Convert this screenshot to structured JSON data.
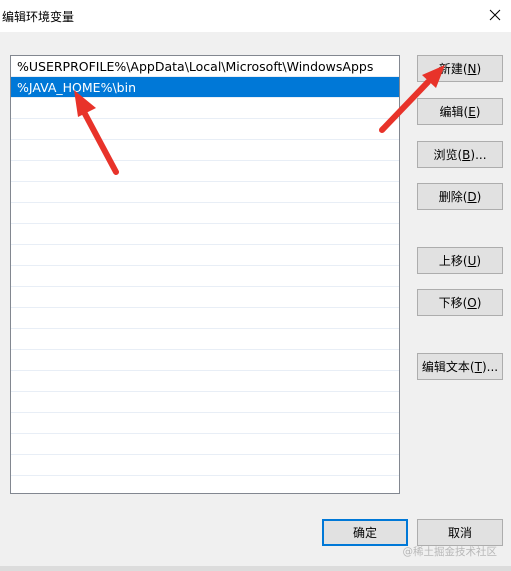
{
  "window": {
    "title": "编辑环境变量",
    "close_glyph": "✕"
  },
  "path_list": {
    "items": [
      {
        "text": "%USERPROFILE%\\AppData\\Local\\Microsoft\\WindowsApps",
        "selected": false
      },
      {
        "text": "%JAVA_HOME%\\bin",
        "selected": true
      }
    ]
  },
  "buttons": {
    "new": {
      "label": "新建(",
      "key": "N",
      "end": ")"
    },
    "edit": {
      "label": "编辑(",
      "key": "E",
      "end": ")"
    },
    "browse": {
      "label": "浏览(",
      "key": "B",
      "end": ")..."
    },
    "delete": {
      "label": "删除(",
      "key": "D",
      "end": ")"
    },
    "move_up": {
      "label": "上移(",
      "key": "U",
      "end": ")"
    },
    "move_down": {
      "label": "下移(",
      "key": "O",
      "end": ")"
    },
    "edit_text": {
      "label": "编辑文本(",
      "key": "T",
      "end": ")..."
    },
    "ok": {
      "label": "确定"
    },
    "cancel": {
      "label": "取消"
    }
  },
  "watermark": "@稀土掘金技术社区",
  "colors": {
    "selection": "#0078d7",
    "annotation_arrow": "#e8332a",
    "default_button_border": "#0078d7"
  }
}
